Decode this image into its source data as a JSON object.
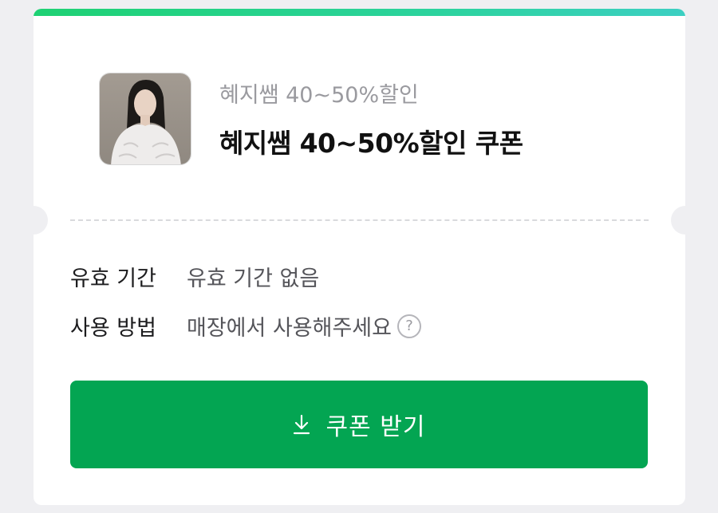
{
  "coupon": {
    "subtitle": "혜지쌤 40~50%할인",
    "title": "혜지쌤 40~50%할인 쿠폰",
    "thumbnail": "profile-photo"
  },
  "details": {
    "validity_label": "유효 기간",
    "validity_value": "유효 기간 없음",
    "usage_label": "사용 방법",
    "usage_value": "매장에서 사용해주세요",
    "help_glyph": "?"
  },
  "action": {
    "button_label": "쿠폰 받기",
    "icon": "download-icon"
  },
  "colors": {
    "accent": "#03a552",
    "bar_start": "#1ed173",
    "bar_end": "#3ccfc2"
  }
}
